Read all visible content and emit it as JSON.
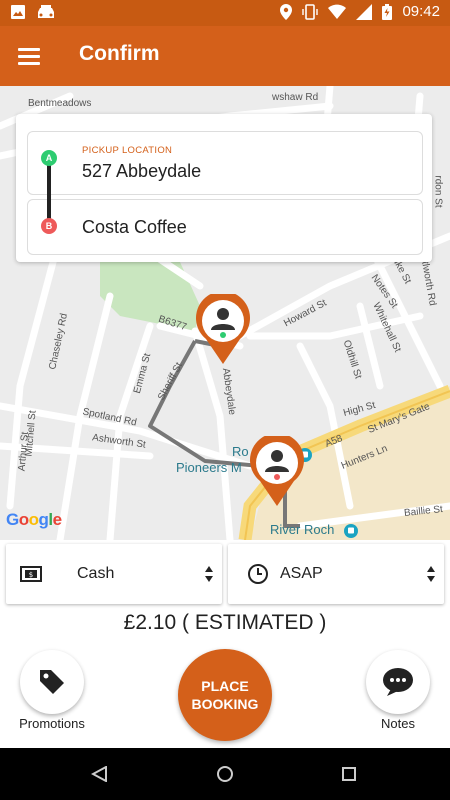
{
  "status_bar": {
    "time": "09:42"
  },
  "app_bar": {
    "title": "Confirm"
  },
  "map": {
    "labels": {
      "bentmeadows": "Bentmeadows",
      "wshaw_rd": "wshaw Rd",
      "rd_top": "Rd",
      "duke_st": "Duke St",
      "rdon_st": "rdon St",
      "worth_rd": "tlworth Rd",
      "howard_st": "Howard St",
      "whitehall_st": "Whitehall St",
      "notes_st": "Notes St",
      "chaseley_rd": "Chaseley Rd",
      "b6377": "B6377",
      "emma_st": "Emma St",
      "sheriff_st": "Sheriff St",
      "abbeydale": "Abbeydale",
      "oldham_st": "Oldhill St",
      "high_st": "High St",
      "st_marys_gate": "St Mary's Gate",
      "a58": "A58",
      "hunters_ln": "Hunters Ln",
      "spotland_rd": "Spotland Rd",
      "ashworth_st": "Ashworth St",
      "mitchell_st": "Mitchell St",
      "arthur_st": "Arthur St",
      "baillie_st": "Baillie St",
      "right_st": "t",
      "roch": "Ro",
      "pioneers": "Pioneers M",
      "river_roch": "River Roch"
    },
    "google": "Google"
  },
  "route": {
    "pickup_caption": "PICKUP LOCATION",
    "pickup_value": "527 Abbeydale",
    "pickup_marker": "A",
    "dropoff_value": "Costa Coffee",
    "dropoff_marker": "B"
  },
  "payment": {
    "label": "Cash",
    "icon": "cash-icon"
  },
  "timing": {
    "label": "ASAP",
    "icon": "clock-icon"
  },
  "price": "£2.10 ( ESTIMATED )",
  "actions": {
    "promotions": "Promotions",
    "place_booking_line1": "PLACE",
    "place_booking_line2": "BOOKING",
    "notes": "Notes"
  },
  "colors": {
    "accent": "#d4601a",
    "status_bar": "#c75a12",
    "marker_a": "#2ecc71",
    "marker_b": "#ee5a5a"
  }
}
